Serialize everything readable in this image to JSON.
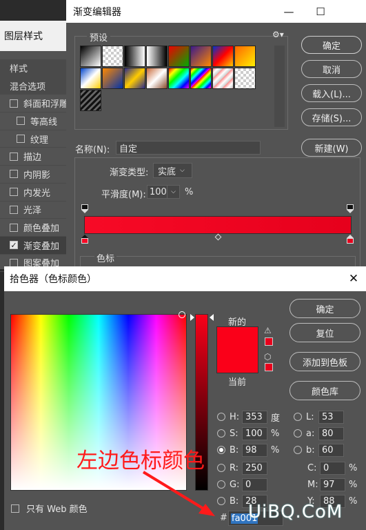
{
  "layer_style": {
    "title": "图层样式",
    "items": [
      {
        "label": "样式",
        "checkbox": false,
        "checked": false,
        "indent": false,
        "plain": true
      },
      {
        "label": "混合选项",
        "checkbox": false,
        "checked": false,
        "indent": false,
        "plain": true
      },
      {
        "label": "斜面和浮雕",
        "checkbox": true,
        "checked": false,
        "indent": false
      },
      {
        "label": "等高线",
        "checkbox": true,
        "checked": false,
        "indent": true
      },
      {
        "label": "纹理",
        "checkbox": true,
        "checked": false,
        "indent": true
      },
      {
        "label": "描边",
        "checkbox": true,
        "checked": false,
        "indent": false
      },
      {
        "label": "内阴影",
        "checkbox": true,
        "checked": false,
        "indent": false
      },
      {
        "label": "内发光",
        "checkbox": true,
        "checked": false,
        "indent": false
      },
      {
        "label": "光泽",
        "checkbox": true,
        "checked": false,
        "indent": false
      },
      {
        "label": "颜色叠加",
        "checkbox": true,
        "checked": false,
        "indent": false
      },
      {
        "label": "渐变叠加",
        "checkbox": true,
        "checked": true,
        "indent": false,
        "active": true
      },
      {
        "label": "图案叠加",
        "checkbox": true,
        "checked": false,
        "indent": false
      }
    ]
  },
  "gradient_editor": {
    "title": "渐变编辑器",
    "minimize_icon": "minimize-icon",
    "maximize_icon": "maximize-icon",
    "presets_label": "预设",
    "gear_icon": "gear-icon",
    "buttons": {
      "ok": "确定",
      "cancel": "取消",
      "load": "载入(L)...",
      "save": "存储(S)...",
      "new": "新建(W)"
    },
    "name_label": "名称(N):",
    "name_value": "自定",
    "gradient_type_label": "渐变类型:",
    "gradient_type_value": "实底",
    "smoothness_label": "平滑度(M):",
    "smoothness_value": "100",
    "smoothness_unit": "%",
    "stops_label": "色标",
    "gradient_colors": [
      "#f70a26",
      "#e6001c"
    ],
    "swatches": [
      "linear-gradient(135deg,#000,#fff)",
      "repeating-conic-gradient(#ccc 0 25%,#fff 0 50%) 0 0/8px 8px",
      "linear-gradient(to right,#000,#fff)",
      "linear-gradient(to right,#fff,#000)",
      "linear-gradient(135deg,#e00,#0a0)",
      "linear-gradient(135deg,#3a1a8a,#f80)",
      "linear-gradient(135deg,#0033cc,#ff0000,#ffcc00)",
      "linear-gradient(135deg,#ff6600,#ffee00)",
      "linear-gradient(135deg,#0044cc,#ffffff,#ffcc00)",
      "linear-gradient(135deg,#ff8800,#0033aa)",
      "linear-gradient(135deg,#2a2a8a,#ffcc00,#2a2a8a)",
      "linear-gradient(135deg,#c96a3a,#fff,#8a4a2a)",
      "linear-gradient(135deg,#f00,#ff0,#0f0,#0ff,#00f,#f0f)",
      "repeating-linear-gradient(135deg,#f00 0,#ff0 4px,#0f0 8px,#0ff 12px,#00f 16px,#f0f 20px)",
      "repeating-linear-gradient(135deg,#f88 0,#fff 5px,#ccc 10px)",
      "repeating-conic-gradient(#ccc 0 25%,#fff 0 50%) 0 0/8px 8px",
      "repeating-linear-gradient(135deg,#111 0,#111 3px,#666 3px,#666 6px)"
    ]
  },
  "color_picker": {
    "title": "拾色器（色标颜色）",
    "close_icon": "close-icon",
    "new_label": "新的",
    "current_label": "当前",
    "new_color": "#fa0019",
    "current_color": "#fa0019",
    "buttons": {
      "ok": "确定",
      "reset": "复位",
      "add_swatch": "添加到色板",
      "library": "颜色库"
    },
    "hsb": [
      {
        "label": "H:",
        "value": "353",
        "unit": "度",
        "selected": false
      },
      {
        "label": "S:",
        "value": "100",
        "unit": "%",
        "selected": false
      },
      {
        "label": "B:",
        "value": "98",
        "unit": "%",
        "selected": true
      }
    ],
    "lab": [
      {
        "label": "L:",
        "value": "53"
      },
      {
        "label": "a:",
        "value": "80"
      },
      {
        "label": "b:",
        "value": "60"
      }
    ],
    "rgb": [
      {
        "label": "R:",
        "value": "250"
      },
      {
        "label": "G:",
        "value": "0"
      },
      {
        "label": "B:",
        "value": "28"
      }
    ],
    "cmyk": [
      {
        "label": "C:",
        "value": "0",
        "unit": "%"
      },
      {
        "label": "M:",
        "value": "97",
        "unit": "%"
      },
      {
        "label": "Y:",
        "value": "88",
        "unit": "%"
      }
    ],
    "hex_label": "#",
    "hex_value": "fa001",
    "web_only_label": "只有 Web 颜色"
  },
  "annotation": "左边色标颜色",
  "watermark": "UiBQ.CoM"
}
